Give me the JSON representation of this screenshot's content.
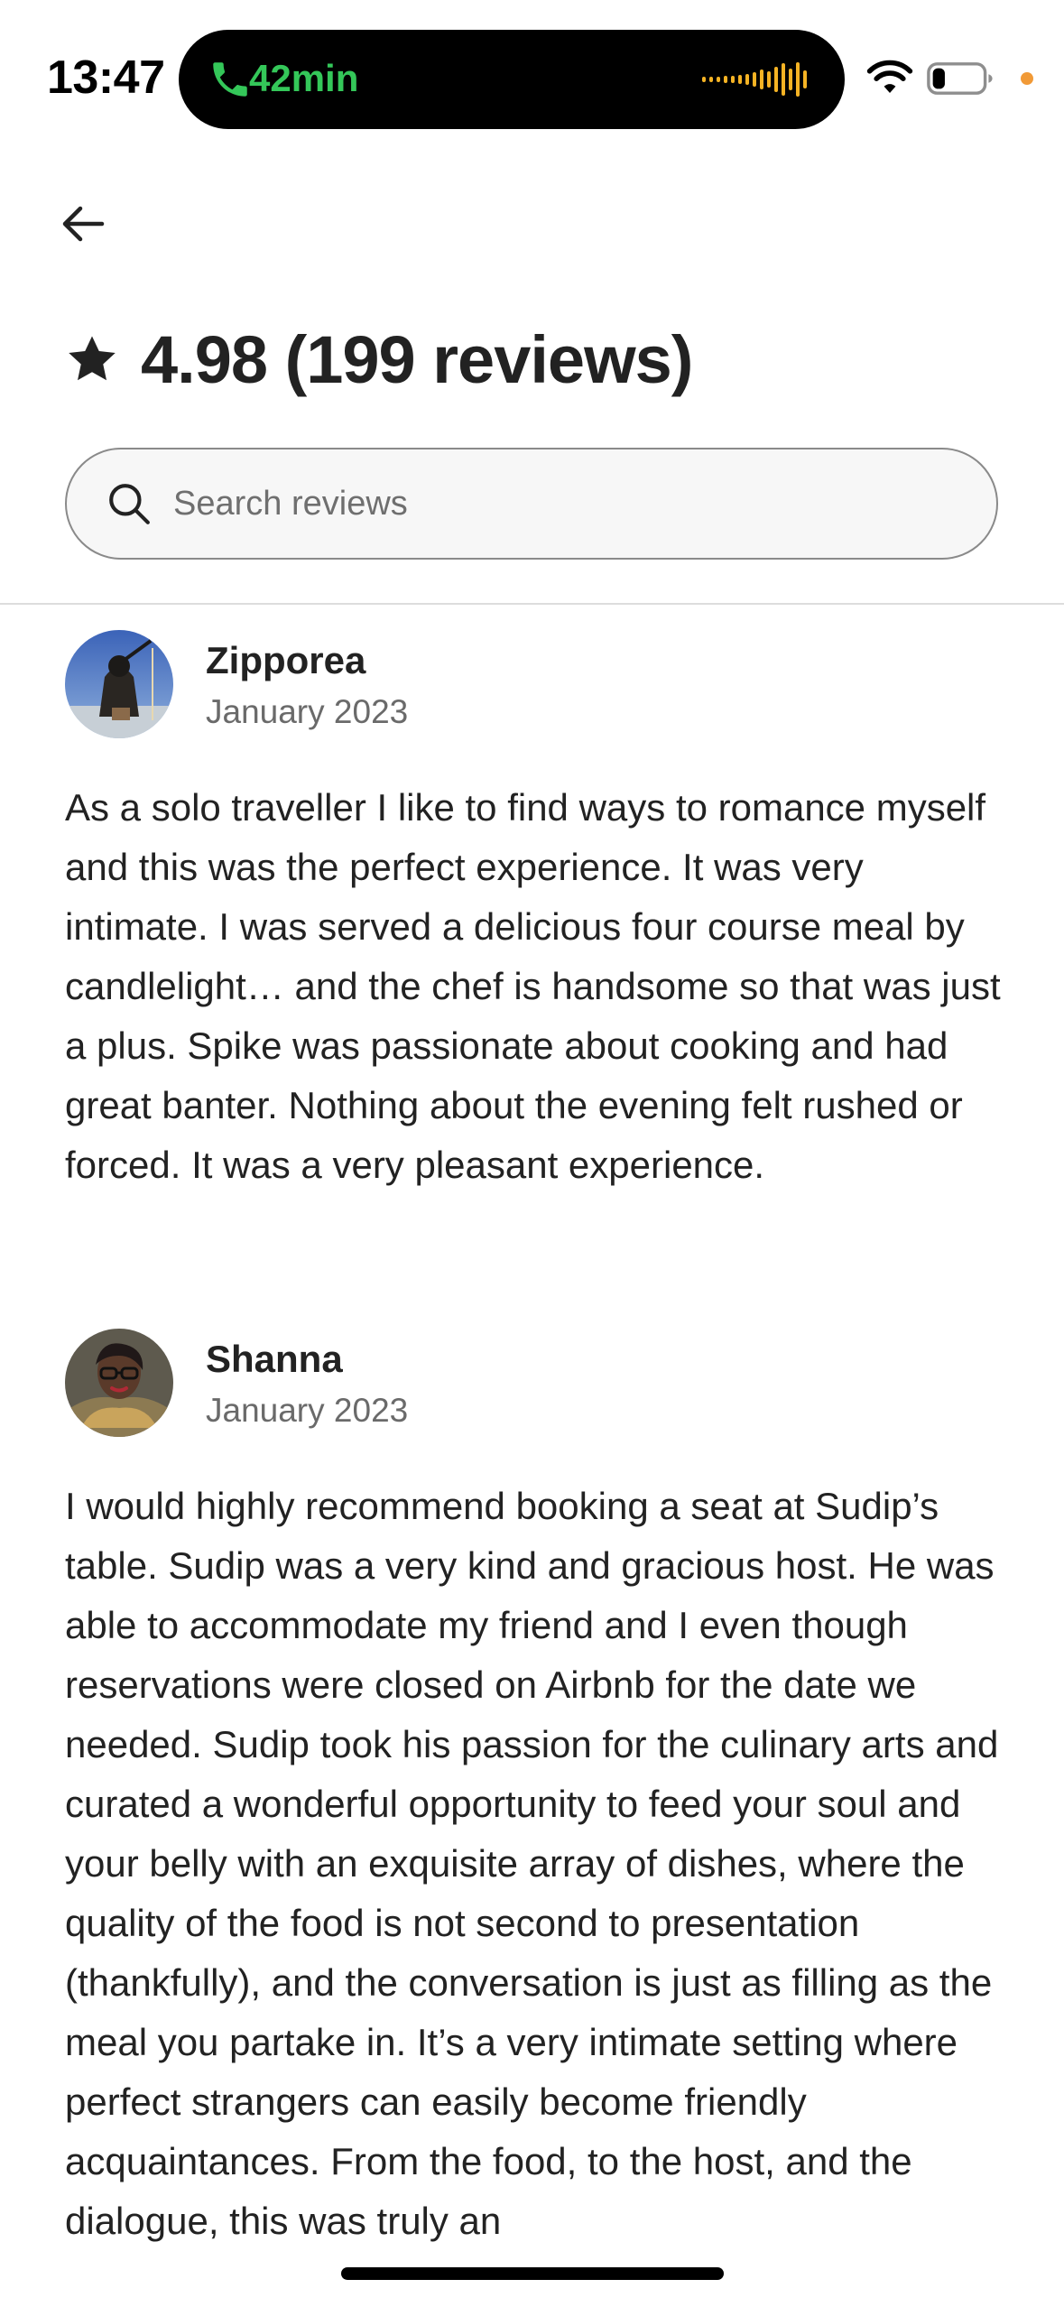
{
  "status_bar": {
    "time": "13:47",
    "call_duration": "42min",
    "call_color": "#34c759",
    "waveform_color": "#f5b324",
    "privacy_dot_color": "#f19a37"
  },
  "header": {
    "rating_summary": "4.98 (199 reviews)"
  },
  "search": {
    "placeholder": "Search reviews",
    "value": ""
  },
  "reviews": [
    {
      "name": "Zipporea",
      "date": "January 2023",
      "text": "As a solo traveller I like to find ways to romance myself and this was the perfect experience. It was very intimate. I was served a delicious four course meal by candlelight… and the chef is handsome so that was just a plus. Spike was passionate about cooking and had great banter. Nothing about the evening felt rushed or forced. It was a very pleasant experience."
    },
    {
      "name": "Shanna",
      "date": "January 2023",
      "text": "I would highly recommend booking a seat at Sudip’s table.  Sudip was a very kind and gracious host.  He was able to accommodate my friend and I even though reservations were closed on Airbnb for the date we needed. Sudip took his passion for the culinary arts and curated a wonderful opportunity to feed your soul and your belly with an exquisite array of dishes, where the quality of the food is not second to presentation (thankfully), and the conversation is just as filling as the meal you partake in.  It’s a very intimate setting where perfect strangers can easily become friendly acquaintances. From the food, to the host, and the dialogue, this was truly an"
    }
  ],
  "icons": {
    "back": "arrow-left-icon",
    "star": "star-icon",
    "search": "search-icon"
  }
}
